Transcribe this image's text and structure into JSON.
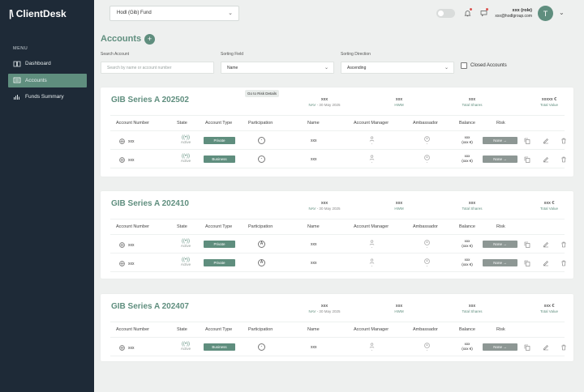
{
  "app": {
    "name": "ClientDesk",
    "logo_mark": "|\\"
  },
  "sidebar": {
    "menu_label": "MENU",
    "items": [
      {
        "label": "Dashboard",
        "icon": "book-icon",
        "active": false
      },
      {
        "label": "Accounts",
        "icon": "accounts-list-icon",
        "active": true
      },
      {
        "label": "Funds Summary",
        "icon": "bar-chart-icon",
        "active": false
      }
    ]
  },
  "topbar": {
    "fund_select": "Hodl (Gib) Fund",
    "user_name": "xxx (role)",
    "user_email": "xxx@hodlgroup.com",
    "avatar_letter": "T"
  },
  "page": {
    "title": "Accounts",
    "add_label": "+"
  },
  "filters": {
    "search_label": "Search Account",
    "search_placeholder": "Search by name or account number",
    "sorting_field_label": "Sorting Field",
    "sorting_field_value": "Name",
    "sorting_direction_label": "Sorting Direction",
    "sorting_direction_value": "Ascending",
    "closed_accounts_label": "Closed Accounts"
  },
  "columns": [
    "Account Number",
    "State",
    "Account Type",
    "Participation",
    "Name",
    "Account Manager",
    "Ambassador",
    "Balance",
    "Risk"
  ],
  "funds": [
    {
      "title": "GIB Series A 202502",
      "risk_link": "Go to Risk Details",
      "nav_value": "xxx",
      "nav_label": "NAV",
      "nav_date": "- 30 May 2025",
      "hwm_value": "xxx",
      "hwm_label": "HWM",
      "shares_value": "xxx",
      "shares_label": "Total Shares",
      "total_value": "xxxxx €",
      "total_label": "Total Value",
      "rows": [
        {
          "account": "xxx",
          "state": "Active",
          "type": "Private",
          "participation": "-",
          "name": "xxx",
          "manager": "-",
          "ambassador": "-",
          "balance": "xxx",
          "balance_sub": "(xxx €)",
          "risk": "None →"
        },
        {
          "account": "xxx",
          "state": "Active",
          "type": "Business",
          "participation": "-",
          "name": "xxx",
          "manager": "-",
          "ambassador": "-",
          "balance": "xxx",
          "balance_sub": "(xxx €)",
          "risk": "None →"
        }
      ]
    },
    {
      "title": "GIB Series A 202410",
      "nav_value": "xxx",
      "nav_label": "NAV",
      "nav_date": "- 30 May 2025",
      "hwm_value": "xxx",
      "hwm_label": "HWM",
      "shares_value": "xxx",
      "shares_label": "Total Shares",
      "total_value": "xxx €",
      "total_label": "Total Value",
      "rows": [
        {
          "account": "xxx",
          "state": "Active",
          "type": "Private",
          "participation": "A",
          "name": "xxx",
          "manager": "-",
          "ambassador": "-",
          "balance": "xxx",
          "balance_sub": "(xxx €)",
          "risk": "None →"
        },
        {
          "account": "xxx",
          "state": "Active",
          "type": "Private",
          "participation": "A",
          "name": "xxx",
          "manager": "-",
          "ambassador": "-",
          "balance": "xxx",
          "balance_sub": "(xxx €)",
          "risk": "None →"
        }
      ]
    },
    {
      "title": "GIB Series A 202407",
      "nav_value": "xxx",
      "nav_label": "NAV",
      "nav_date": "- 30 May 2025",
      "hwm_value": "xxx",
      "hwm_label": "HWM",
      "shares_value": "xxx",
      "shares_label": "Total Shares",
      "total_value": "xxx €",
      "total_label": "Total Value",
      "rows": [
        {
          "account": "xxx",
          "state": "Active",
          "type": "Business",
          "participation": "-",
          "name": "xxx",
          "manager": "-",
          "ambassador": "-",
          "balance": "xxx",
          "balance_sub": "(xxx €)",
          "risk": "None →"
        }
      ]
    }
  ],
  "colors": {
    "accent": "#5f8e7e",
    "sidebar_bg": "#1e2a37",
    "page_bg": "#eef0ef",
    "risk_pill": "#8d9794"
  }
}
